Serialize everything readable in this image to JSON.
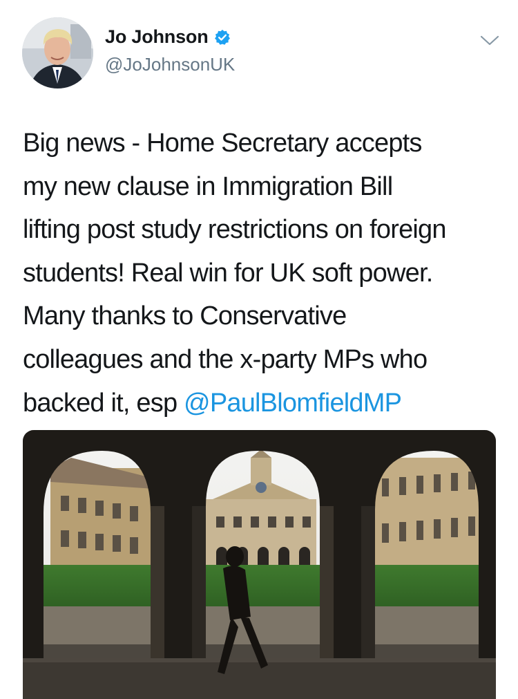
{
  "tweet": {
    "author": {
      "display_name": "Jo Johnson",
      "handle": "@JoJohnsonUK",
      "verified": true,
      "verified_icon": "verified-badge-icon"
    },
    "menu_icon": "chevron-down-icon",
    "text_segments": [
      "Big news - Home Secretary accepts",
      "my new clause in Immigration Bill",
      "lifting post study restrictions on foreign",
      "students! Real win for UK soft power.",
      "Many thanks to Conservative",
      "colleagues and the x-party MPs who"
    ],
    "last_line_prefix": "backed it, esp ",
    "mention": "@PaulBlomfieldMP"
  },
  "colors": {
    "text": "#14171a",
    "secondary": "#657786",
    "link": "#1b95e0",
    "verified": "#1da1f2"
  }
}
